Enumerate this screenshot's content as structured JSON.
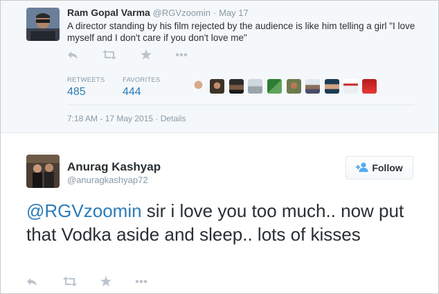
{
  "tweet1": {
    "display_name": "Ram Gopal Varma",
    "handle": "@RGVzoomin",
    "date_separator": "·",
    "date": "May 17",
    "text": "A director standing by his film rejected by the audience is like him telling a girl \"I love myself and I don't care if you don't love me\"",
    "icons": [
      "reply-icon",
      "retweet-icon",
      "favorite-icon",
      "more-icon"
    ],
    "stats": {
      "retweets_label": "RETWEETS",
      "retweets_value": "485",
      "favorites_label": "FAVORITES",
      "favorites_value": "444"
    },
    "timestamp": "7:18 AM - 17 May 2015",
    "separator": "·",
    "details_label": "Details"
  },
  "tweet2": {
    "display_name": "Anurag Kashyap",
    "handle": "@anuragkashyap72",
    "follow_label": "Follow",
    "mention": "@RGVzoomin",
    "text": " sir i love you too much.. now put that Vodka aside and sleep.. lots of kisses",
    "icons": [
      "reply-icon",
      "retweet-icon",
      "favorite-icon",
      "more-icon"
    ]
  },
  "colors": {
    "link": "#2b7bb9",
    "muted": "#8899a6",
    "icon": "#bbc4cc",
    "text": "#292f33"
  }
}
